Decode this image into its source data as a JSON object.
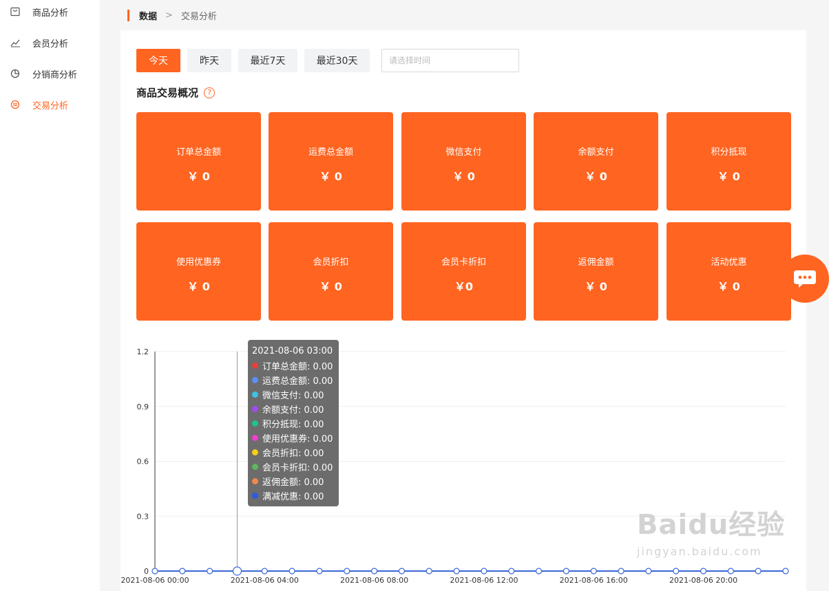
{
  "sidebar": {
    "items": [
      {
        "label": "商品分析",
        "icon": "box-icon"
      },
      {
        "label": "会员分析",
        "icon": "line-chart-icon"
      },
      {
        "label": "分销商分析",
        "icon": "pie-chart-icon"
      },
      {
        "label": "交易分析",
        "icon": "exchange-icon",
        "active": true
      }
    ]
  },
  "breadcrumb": {
    "root": "数据",
    "separator": ">",
    "current": "交易分析"
  },
  "filters": {
    "buttons": [
      "今天",
      "昨天",
      "最近7天",
      "最近30天"
    ],
    "active": "今天",
    "date_placeholder": "请选择时间"
  },
  "overview": {
    "title": "商品交易概况",
    "help": "?",
    "cards": [
      {
        "title": "订单总金额",
        "value": "￥ 0"
      },
      {
        "title": "运费总金额",
        "value": "￥ 0"
      },
      {
        "title": "微信支付",
        "value": "￥ 0"
      },
      {
        "title": "余额支付",
        "value": "￥ 0"
      },
      {
        "title": "积分抵现",
        "value": "￥ 0"
      },
      {
        "title": "使用优惠券",
        "value": "￥ 0"
      },
      {
        "title": "会员折扣",
        "value": "￥ 0"
      },
      {
        "title": "会员卡折扣",
        "value": "￥0"
      },
      {
        "title": "返佣金额",
        "value": "￥ 0"
      },
      {
        "title": "活动优惠",
        "value": "￥ 0"
      }
    ]
  },
  "colors": {
    "accent": "#ff6420",
    "line": "#3b66d8"
  },
  "tooltip": {
    "title": "2021-08-06 03:00",
    "rows": [
      {
        "label": "订单总金额: 0.00",
        "color": "#e8403a"
      },
      {
        "label": "运费总金额: 0.00",
        "color": "#5b8ff9"
      },
      {
        "label": "微信支付: 0.00",
        "color": "#3fc1e8"
      },
      {
        "label": "余额支付: 0.00",
        "color": "#a24cf0"
      },
      {
        "label": "积分抵现: 0.00",
        "color": "#1fc48a"
      },
      {
        "label": "使用优惠券: 0.00",
        "color": "#f03fd0"
      },
      {
        "label": "会员折扣: 0.00",
        "color": "#f5d013"
      },
      {
        "label": "会员卡折扣: 0.00",
        "color": "#5cb85c"
      },
      {
        "label": "返佣金额: 0.00",
        "color": "#f08a4b"
      },
      {
        "label": "满减优惠: 0.00",
        "color": "#2d5ae0"
      }
    ]
  },
  "chart_data": {
    "type": "line",
    "x": [
      "00:00",
      "01:00",
      "02:00",
      "03:00",
      "04:00",
      "05:00",
      "06:00",
      "07:00",
      "08:00",
      "09:00",
      "10:00",
      "11:00",
      "12:00",
      "13:00",
      "14:00",
      "15:00",
      "16:00",
      "17:00",
      "18:00",
      "19:00",
      "20:00",
      "21:00",
      "22:00",
      "23:00"
    ],
    "x_tick_labels": [
      "2021-08-06 00:00",
      "2021-08-06 04:00",
      "2021-08-06 08:00",
      "2021-08-06 12:00",
      "2021-08-06 16:00",
      "2021-08-06 20:00"
    ],
    "series": [
      {
        "name": "订单总金额",
        "values": [
          0,
          0,
          0,
          0,
          0,
          0,
          0,
          0,
          0,
          0,
          0,
          0,
          0,
          0,
          0,
          0,
          0,
          0,
          0,
          0,
          0,
          0,
          0,
          0
        ]
      },
      {
        "name": "运费总金额",
        "values": [
          0,
          0,
          0,
          0,
          0,
          0,
          0,
          0,
          0,
          0,
          0,
          0,
          0,
          0,
          0,
          0,
          0,
          0,
          0,
          0,
          0,
          0,
          0,
          0
        ]
      },
      {
        "name": "微信支付",
        "values": [
          0,
          0,
          0,
          0,
          0,
          0,
          0,
          0,
          0,
          0,
          0,
          0,
          0,
          0,
          0,
          0,
          0,
          0,
          0,
          0,
          0,
          0,
          0,
          0
        ]
      },
      {
        "name": "余额支付",
        "values": [
          0,
          0,
          0,
          0,
          0,
          0,
          0,
          0,
          0,
          0,
          0,
          0,
          0,
          0,
          0,
          0,
          0,
          0,
          0,
          0,
          0,
          0,
          0,
          0
        ]
      },
      {
        "name": "积分抵现",
        "values": [
          0,
          0,
          0,
          0,
          0,
          0,
          0,
          0,
          0,
          0,
          0,
          0,
          0,
          0,
          0,
          0,
          0,
          0,
          0,
          0,
          0,
          0,
          0,
          0
        ]
      },
      {
        "name": "使用优惠券",
        "values": [
          0,
          0,
          0,
          0,
          0,
          0,
          0,
          0,
          0,
          0,
          0,
          0,
          0,
          0,
          0,
          0,
          0,
          0,
          0,
          0,
          0,
          0,
          0,
          0
        ]
      },
      {
        "name": "会员折扣",
        "values": [
          0,
          0,
          0,
          0,
          0,
          0,
          0,
          0,
          0,
          0,
          0,
          0,
          0,
          0,
          0,
          0,
          0,
          0,
          0,
          0,
          0,
          0,
          0,
          0
        ]
      },
      {
        "name": "会员卡折扣",
        "values": [
          0,
          0,
          0,
          0,
          0,
          0,
          0,
          0,
          0,
          0,
          0,
          0,
          0,
          0,
          0,
          0,
          0,
          0,
          0,
          0,
          0,
          0,
          0,
          0
        ]
      },
      {
        "name": "返佣金额",
        "values": [
          0,
          0,
          0,
          0,
          0,
          0,
          0,
          0,
          0,
          0,
          0,
          0,
          0,
          0,
          0,
          0,
          0,
          0,
          0,
          0,
          0,
          0,
          0,
          0
        ]
      },
      {
        "name": "满减优惠",
        "values": [
          0,
          0,
          0,
          0,
          0,
          0,
          0,
          0,
          0,
          0,
          0,
          0,
          0,
          0,
          0,
          0,
          0,
          0,
          0,
          0,
          0,
          0,
          0,
          0
        ]
      }
    ],
    "y_ticks": [
      "0",
      "0.3",
      "0.6",
      "0.9",
      "1.2"
    ],
    "ylim": [
      0,
      1.2
    ],
    "grid": true,
    "hover_index": 3
  },
  "watermark": {
    "big": "Baidu经验",
    "small": "jingyan.baidu.com"
  }
}
